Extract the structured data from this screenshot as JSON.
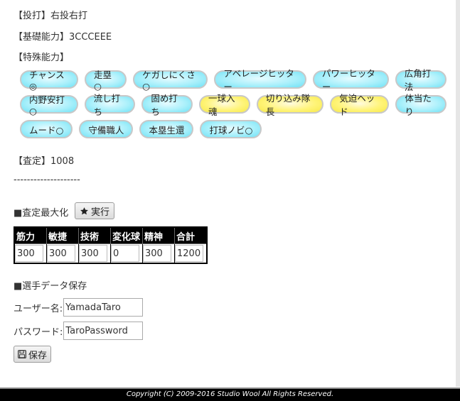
{
  "lines": {
    "pitching_batting": "【投打】右投右打",
    "basic_ability": "【基礎能力】3CCCEEE",
    "special_ability_heading": "【特殊能力】",
    "assessment": "【査定】1008",
    "divider": "--------------------",
    "maximize_heading": "■査定最大化",
    "save_heading": "■選手データ保存"
  },
  "tags": [
    [
      {
        "label": "チャンス◎",
        "color": "blue"
      },
      {
        "label": "走塁○",
        "color": "blue"
      },
      {
        "label": "ケガしにくさ○",
        "color": "blue"
      },
      {
        "label": "アベレージヒッター",
        "color": "blue"
      },
      {
        "label": "パワーヒッター",
        "color": "blue"
      },
      {
        "label": "広角打法",
        "color": "blue"
      }
    ],
    [
      {
        "label": "内野安打○",
        "color": "blue"
      },
      {
        "label": "流し打ち",
        "color": "blue"
      },
      {
        "label": "固め打ち",
        "color": "blue"
      },
      {
        "label": "一球入魂",
        "color": "gold"
      },
      {
        "label": "切り込み隊長",
        "color": "gold"
      },
      {
        "label": "気迫ヘッド",
        "color": "gold"
      },
      {
        "label": "体当たり",
        "color": "blue"
      }
    ],
    [
      {
        "label": "ムード○",
        "color": "blue"
      },
      {
        "label": "守備職人",
        "color": "blue"
      },
      {
        "label": "本塁生還",
        "color": "blue"
      },
      {
        "label": "打球ノビ○",
        "color": "blue"
      }
    ]
  ],
  "buttons": {
    "execute_label": "実行",
    "save_label": "保存"
  },
  "stats_table": {
    "headers": [
      "筋力",
      "敏捷",
      "技術",
      "変化球",
      "精神",
      "合計"
    ],
    "values": [
      "300",
      "300",
      "300",
      "0",
      "300",
      "1200"
    ]
  },
  "form": {
    "username_label": "ユーザー名:",
    "username_value": "YamadaTaro",
    "password_label": "パスワード:",
    "password_value": "TaroPassword"
  },
  "footer": {
    "copyright": "Copyright (C) 2009-2016 Studio Wool All Rights Reserved."
  },
  "colors": {
    "tag_blue": "#aaf0fb",
    "tag_gold": "#fff479",
    "footer_bg": "#000000"
  }
}
